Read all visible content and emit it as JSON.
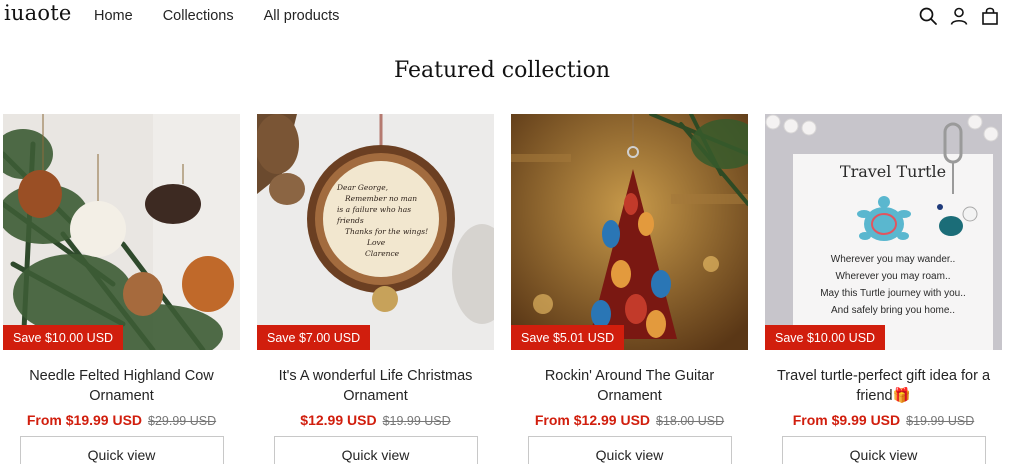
{
  "header": {
    "logo": "iuaote",
    "nav": [
      "Home",
      "Collections",
      "All products"
    ]
  },
  "section": {
    "title": "Featured collection"
  },
  "products": [
    {
      "badge": "Save $10.00 USD",
      "title": "Needle Felted Highland Cow Ornament",
      "price": "From $19.99 USD",
      "compare_price": "$29.99 USD",
      "button": "Quick view"
    },
    {
      "badge": "Save $7.00 USD",
      "title": "It's A wonderful Life Christmas Ornament",
      "price": "$12.99 USD",
      "compare_price": "$19.99 USD",
      "button": "Quick view"
    },
    {
      "badge": "Save $5.01 USD",
      "title": "Rockin' Around The Guitar Ornament",
      "price": "From $12.99 USD",
      "compare_price": "$18.00 USD",
      "button": "Quick view"
    },
    {
      "badge": "Save $10.00 USD",
      "title": "Travel turtle-perfect gift idea for a friend🎁",
      "price": "From $9.99 USD",
      "compare_price": "$19.99 USD",
      "button": "Quick view"
    }
  ],
  "image_text": {
    "letter": [
      "Dear George,",
      "Remember no man",
      "is a failure who has",
      "friends",
      "Thanks for the wings!",
      "Love",
      "Clarence"
    ],
    "turtle_card": {
      "title": "Travel Turtle",
      "lines": [
        "Wherever you may wander..",
        "Wherever you may roam..",
        "May this Turtle journey with you..",
        "And safely bring you home.."
      ]
    }
  },
  "colors": {
    "accent": "#d11e0d",
    "text": "#121212"
  },
  "icons": [
    "search-icon",
    "account-icon",
    "cart-icon"
  ]
}
